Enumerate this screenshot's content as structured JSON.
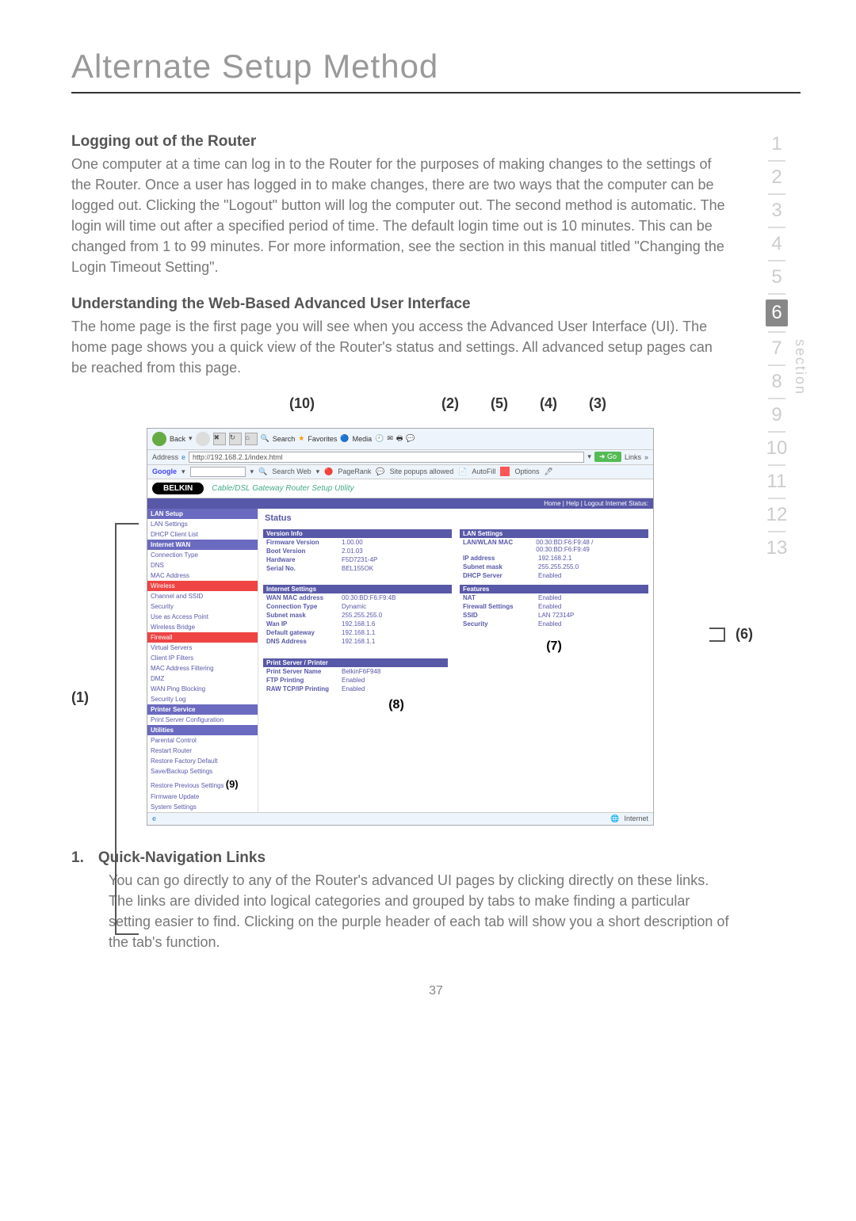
{
  "chapter_title": "Alternate Setup Method",
  "h1": "Logging out of the Router",
  "p1": "One computer at a time can log in to the Router for the purposes of making changes to the settings of the Router. Once a user has logged in to make changes, there are two ways that the computer can be logged out. Clicking the \"Logout\" button will log the computer out. The second method is automatic. The login will time out after a specified period of time. The default login time out is 10 minutes. This can be changed from 1 to 99 minutes. For more information, see the section in this manual titled \"Changing the Login Timeout Setting\".",
  "h2": "Understanding the Web-Based Advanced User Interface",
  "p2": "The home page is the first page you will see when you access the Advanced User Interface (UI). The home page shows you a quick view of the Router's status and settings. All advanced setup pages can be reached from this page.",
  "sidenav": {
    "items": [
      "1",
      "2",
      "3",
      "4",
      "5",
      "6",
      "7",
      "8",
      "9",
      "10",
      "11",
      "12",
      "13"
    ],
    "active": "6",
    "label": "section"
  },
  "callouts": {
    "c1": "(1)",
    "c2": "(2)",
    "c3": "(3)",
    "c4": "(4)",
    "c5": "(5)",
    "c6": "(6)",
    "c7": "(7)",
    "c8": "(8)",
    "c9": "(9)",
    "c10": "(10)"
  },
  "browser": {
    "back": "Back",
    "search": "Search",
    "favorites": "Favorites",
    "media": "Media",
    "addr_label": "Address",
    "url": "http://192.168.2.1/index.html",
    "go": "Go",
    "links": "Links",
    "google": "Google",
    "search_web": "Search Web",
    "pagerank": "PageRank",
    "popups": "Site popups allowed",
    "autofill": "AutoFill",
    "options": "Options"
  },
  "belkin": {
    "brand": "BELKIN",
    "sub": "Cable/DSL Gateway Router Setup Utility"
  },
  "util_header": "Home | Help | Logout   Internet Status:",
  "nav": {
    "lan_setup": "LAN Setup",
    "lan_settings": "LAN Settings",
    "dhcp": "DHCP Client List",
    "internet_wan": "Internet WAN",
    "conn_type": "Connection Type",
    "dns": "DNS",
    "mac": "MAC Address",
    "wireless": "Wireless",
    "chan": "Channel and SSID",
    "sec": "Security",
    "uap": "Use as Access Point",
    "wb": "Wireless Bridge",
    "firewall": "Firewall",
    "vs": "Virtual Servers",
    "cip": "Client IP Filters",
    "macf": "MAC Address Filtering",
    "dmz": "DMZ",
    "wpb": "WAN Ping Blocking",
    "slog": "Security Log",
    "printer": "Printer Service",
    "psc": "Print Server Configuration",
    "utilities": "Utilities",
    "pc": "Parental Control",
    "rr": "Restart Router",
    "rfd": "Restore Factory Default",
    "sbs": "Save/Backup Settings",
    "rps": "Restore Previous Settings",
    "fu": "Firmware Update",
    "ss": "System Settings"
  },
  "status_title": "Status",
  "version_info": {
    "head": "Version Info",
    "fw_k": "Firmware Version",
    "fw_v": "1.00.00",
    "bv_k": "Boot Version",
    "bv_v": "2.01.03",
    "hw_k": "Hardware",
    "hw_v": "F5D7231-4P",
    "sn_k": "Serial No.",
    "sn_v": "BEL155OK"
  },
  "lan_settings": {
    "head": "LAN Settings",
    "mac_k": "LAN/WLAN MAC",
    "mac_v": "00:30:BD:F6:F9:48 / 00:30:BD:F6:F9:49",
    "ip_k": "IP address",
    "ip_v": "192.168.2.1",
    "sm_k": "Subnet mask",
    "sm_v": "255.255.255.0",
    "dh_k": "DHCP Server",
    "dh_v": "Enabled"
  },
  "internet_settings": {
    "head": "Internet Settings",
    "wm_k": "WAN MAC address",
    "wm_v": "00:30:BD:F6:F9:4B",
    "ct_k": "Connection Type",
    "ct_v": "Dynamic",
    "sm_k": "Subnet mask",
    "sm_v": "255.255.255.0",
    "wi_k": "Wan IP",
    "wi_v": "192.168.1.6",
    "dg_k": "Default gateway",
    "dg_v": "192.168.1.1",
    "dn_k": "DNS Address",
    "dn_v": "192.168.1.1"
  },
  "features": {
    "head": "Features",
    "nat_k": "NAT",
    "nat_v": "Enabled",
    "fw_k": "Firewall Settings",
    "fw_v": "Enabled",
    "ss_k": "SSID",
    "ss_v": "LAN  72314P",
    "sec_k": "Security",
    "sec_v": "Enabled"
  },
  "print_server": {
    "head": "Print Server / Printer",
    "pn_k": "Print Server Name",
    "pn_v": "BelkinF6F948",
    "ftp_k": "FTP Printing",
    "ftp_v": "Enabled",
    "raw_k": "RAW TCP/IP Printing",
    "raw_v": "Enabled"
  },
  "status_bar": "Internet",
  "list": {
    "num": "1.",
    "title": "Quick-Navigation Links",
    "body": "You can go directly to any of the Router's advanced UI pages by clicking directly on these links. The links are divided into logical categories and grouped by tabs to make finding a particular setting easier to find. Clicking on the purple header of each tab will show you a short description of the tab's function."
  },
  "page_number": "37"
}
